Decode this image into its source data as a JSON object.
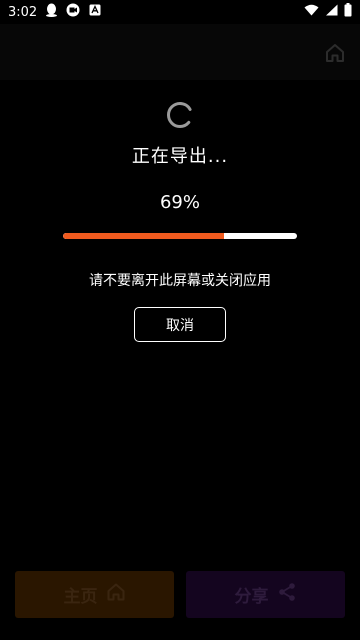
{
  "status_bar": {
    "time": "3:02",
    "icons": [
      "qq-icon",
      "video-camera-icon",
      "a-badge-icon",
      "wifi-icon",
      "signal-icon",
      "battery-icon"
    ]
  },
  "top_bar": {
    "right_icon": "home-icon"
  },
  "export_dialog": {
    "title": "正在导出...",
    "percent_text": "69%",
    "progress": 0.69,
    "message": "请不要离开此屏幕或关闭应用",
    "cancel_label": "取消"
  },
  "bottom_nav": {
    "home_label": "主页",
    "share_label": "分享"
  },
  "colors": {
    "progress_fill": "#f05a1e",
    "progress_track": "#ffffff",
    "home_button_bg": "#2a1600",
    "share_button_bg": "#14051f"
  }
}
